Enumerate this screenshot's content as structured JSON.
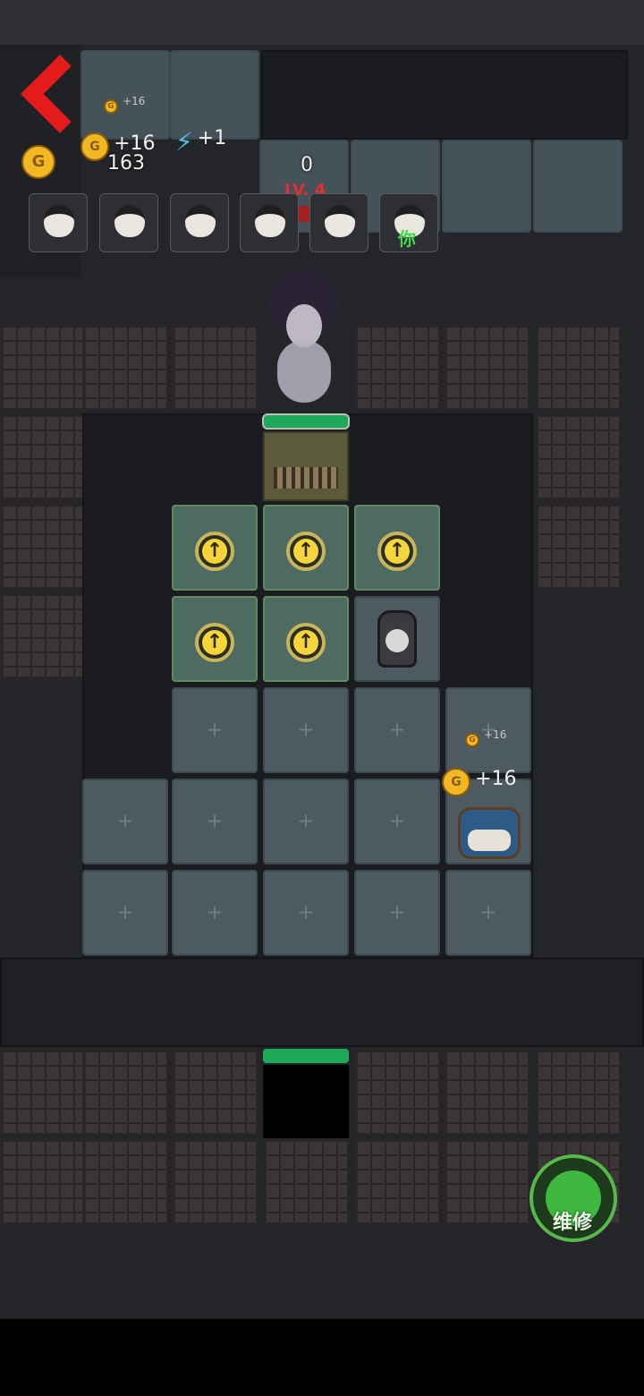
{
  "hud": {
    "back_icon": "chevron-left-icon",
    "gold_total": "163",
    "gold_gain": "+16",
    "energy_gain": "+1",
    "enemy_hp": "0",
    "enemy_level": "LV. 4",
    "repair_button_label": "维修",
    "player_tag": "你",
    "characters": [
      {
        "name": "character-1"
      },
      {
        "name": "character-2"
      },
      {
        "name": "character-3"
      },
      {
        "name": "character-4"
      },
      {
        "name": "character-5"
      },
      {
        "name": "character-you"
      }
    ]
  },
  "room": {
    "bed_gain_small": "+16",
    "bed_gain": "+16",
    "small_gain_top": "+16"
  },
  "colors": {
    "accent_green": "#1fa85a",
    "coin_gold": "#f2b824",
    "level_red": "#e03030"
  }
}
